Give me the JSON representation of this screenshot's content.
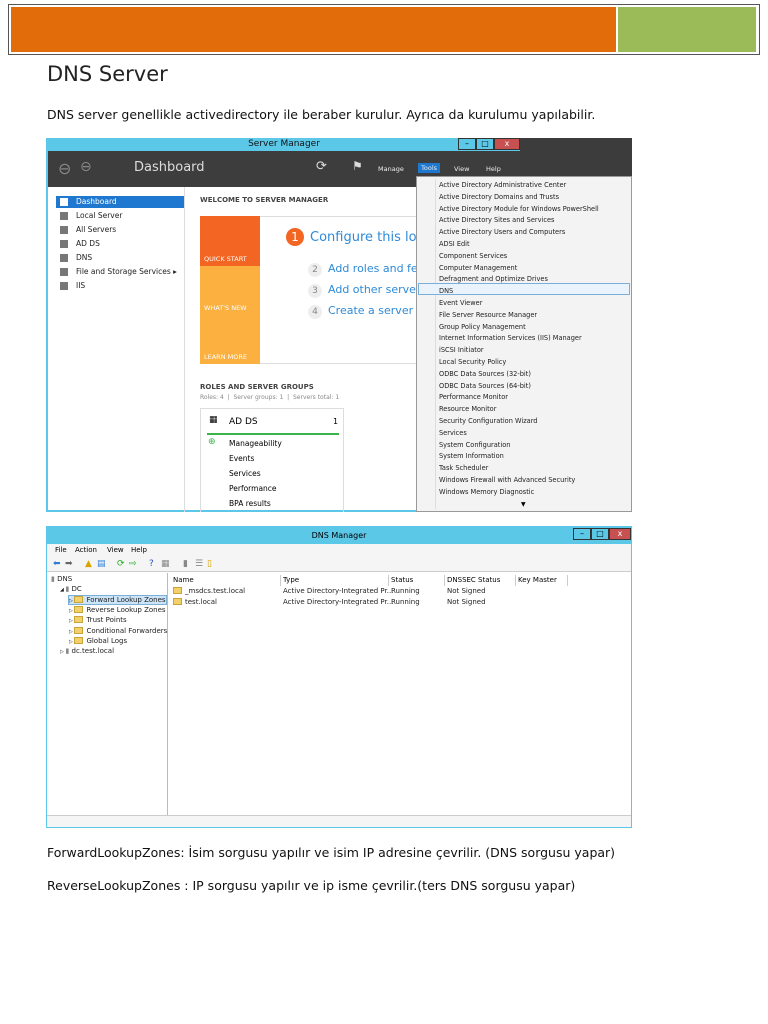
{
  "title": "DNS Server",
  "intro": "DNS server genellikle activedirectory ile beraber kurulur. Ayrıca da kurulumu yapılabilir.",
  "server_manager": {
    "window_title": "Server Manager",
    "breadcrumb": "Dashboard",
    "menus": [
      "Manage",
      "Tools",
      "View",
      "Help"
    ],
    "sidebar": [
      "Dashboard",
      "Local Server",
      "All Servers",
      "AD DS",
      "DNS",
      "File and Storage Services",
      "IIS"
    ],
    "welcome": "WELCOME TO SERVER MANAGER",
    "tiles": [
      "QUICK START",
      "WHAT'S NEW",
      "LEARN MORE"
    ],
    "steps": [
      {
        "n": "1",
        "t": "Configure this local server"
      },
      {
        "n": "2",
        "t": "Add roles and features"
      },
      {
        "n": "3",
        "t": "Add other servers to manage"
      },
      {
        "n": "4",
        "t": "Create a server group"
      }
    ],
    "roles_title": "ROLES AND SERVER GROUPS",
    "roles_summary": "Roles: 4  |  Server groups: 1  |  Servers total: 1",
    "role_card": {
      "name": "AD DS",
      "count": "1",
      "items": [
        "Manageability",
        "Events",
        "Services",
        "Performance",
        "BPA results"
      ]
    },
    "tools_menu": [
      "Active Directory Administrative Center",
      "Active Directory Domains and Trusts",
      "Active Directory Module for Windows PowerShell",
      "Active Directory Sites and Services",
      "Active Directory Users and Computers",
      "ADSI Edit",
      "Component Services",
      "Computer Management",
      "Defragment and Optimize Drives",
      "DNS",
      "Event Viewer",
      "File Server Resource Manager",
      "Group Policy Management",
      "Internet Information Services (IIS) Manager",
      "iSCSI Initiator",
      "Local Security Policy",
      "ODBC Data Sources (32-bit)",
      "ODBC Data Sources (64-bit)",
      "Performance Monitor",
      "Resource Monitor",
      "Security Configuration Wizard",
      "Services",
      "System Configuration",
      "System Information",
      "Task Scheduler",
      "Windows Firewall with Advanced Security",
      "Windows Memory Diagnostic"
    ],
    "selected_tool": "DNS"
  },
  "dns_manager": {
    "window_title": "DNS Manager",
    "menus": [
      "File",
      "Action",
      "View",
      "Help"
    ],
    "tree": [
      {
        "label": "DNS",
        "level": 0
      },
      {
        "label": "DC",
        "level": 1
      },
      {
        "label": "Forward Lookup Zones",
        "level": 2
      },
      {
        "label": "Reverse Lookup Zones",
        "level": 2
      },
      {
        "label": "Trust Points",
        "level": 2
      },
      {
        "label": "Conditional Forwarders",
        "level": 2
      },
      {
        "label": "Global Logs",
        "level": 2
      },
      {
        "label": "dc.test.local",
        "level": 1
      }
    ],
    "columns": [
      "Name",
      "Type",
      "Status",
      "DNSSEC Status",
      "Key Master"
    ],
    "rows": [
      [
        "_msdcs.test.local",
        "Active Directory-Integrated Pr...",
        "Running",
        "Not Signed",
        ""
      ],
      [
        "test.local",
        "Active Directory-Integrated Pr...",
        "Running",
        "Not Signed",
        ""
      ]
    ]
  },
  "forward_text": "ForwardLookupZones: İsim sorgusu yapılır ve isim IP adresine çevrilir. (DNS sorgusu yapar)",
  "reverse_text": "ReverseLookupZones : IP sorgusu yapılır ve ip isme çevrilir.(ters DNS sorgusu yapar)"
}
